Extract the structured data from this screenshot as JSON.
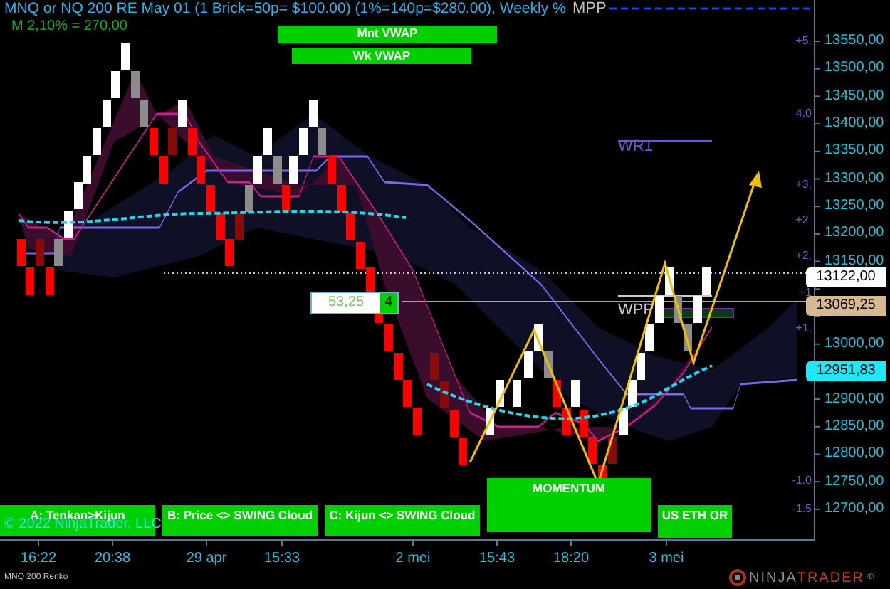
{
  "title": "MNQ or NQ 200 RE May 01 (1 Brick=50p= $100.00) (1%=140p=$280.00), Weekly %",
  "subtitle": "M 2,10% = 270,00",
  "top_signals": [
    {
      "label": "Mnt VWAP"
    },
    {
      "label": "Wk VWAP"
    }
  ],
  "level_labels": [
    {
      "text": "MPP"
    },
    {
      "text": "WR1"
    },
    {
      "text": "WPP"
    }
  ],
  "value_box": {
    "value": "53,25",
    "count": "4"
  },
  "percent_marks": [
    "+5,",
    "4.0",
    "+3,",
    "+2.",
    "+2,",
    "+1",
    "+1,",
    "-1.0",
    "-1.5"
  ],
  "price_ticks": [
    "13550,00",
    "13500,00",
    "13450,00",
    "13400,00",
    "13350,00",
    "13300,00",
    "13250,00",
    "13200,00",
    "13150,00",
    "13000,00",
    "12900,00",
    "12850,00",
    "12800,00",
    "12750,00",
    "12700,00"
  ],
  "price_badges": [
    {
      "text": "13122,00",
      "color": "#ffffff"
    },
    {
      "text": "13069,25",
      "color": "#d8b890"
    },
    {
      "text": "12951,83",
      "color": "#20e8f8"
    }
  ],
  "bottom_signals": [
    {
      "label": "A: Tenkan>Kijun"
    },
    {
      "label": "B: Price <> SWING Cloud"
    },
    {
      "label": "C: Kijun <> SWING Cloud"
    },
    {
      "label": "MOMENTUM"
    },
    {
      "label": "US ETH OR"
    }
  ],
  "copyright": "© 2022 NinjaTrader, LLC",
  "time_axis": [
    "16:22",
    "20:38",
    "29 apr",
    "15:33",
    "2 mei",
    "15:43",
    "18:20",
    "3 mei"
  ],
  "instrument_label": "MNQ 200 Renko",
  "logo": {
    "part_1": "NINJA",
    "part_2": "TRADER",
    "mark": "®"
  }
}
